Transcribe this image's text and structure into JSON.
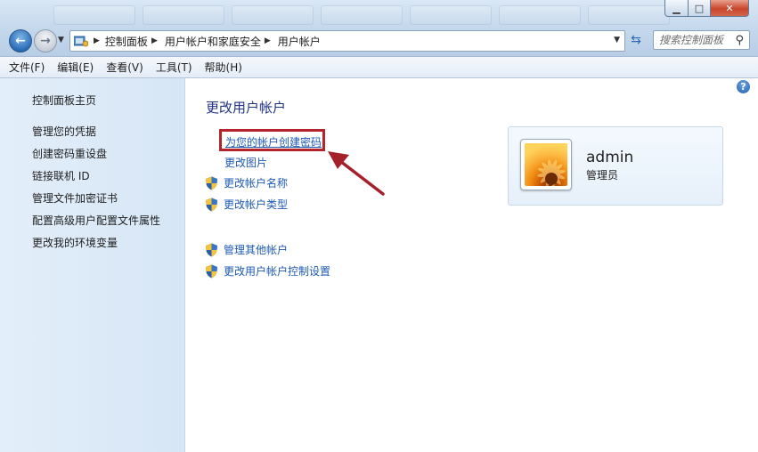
{
  "window": {
    "minimize_glyph": "▁",
    "maximize_glyph": "□",
    "close_glyph": "✕"
  },
  "address_bar": {
    "crumbs": [
      "控制面板",
      "用户帐户和家庭安全",
      "用户帐户"
    ],
    "search_placeholder": "搜索控制面板"
  },
  "menu": {
    "items": [
      "文件(F)",
      "编辑(E)",
      "查看(V)",
      "工具(T)",
      "帮助(H)"
    ]
  },
  "sidebar": {
    "items": [
      "控制面板主页",
      "管理您的凭据",
      "创建密码重设盘",
      "链接联机 ID",
      "管理文件加密证书",
      "配置高级用户配置文件属性",
      "更改我的环境变量"
    ]
  },
  "main": {
    "title": "更改用户帐户",
    "tasks": [
      "为您的帐户创建密码",
      "更改图片",
      "更改帐户名称",
      "更改帐户类型"
    ],
    "other_tasks": [
      "管理其他帐户",
      "更改用户帐户控制设置"
    ],
    "help_glyph": "?"
  },
  "user": {
    "name": "admin",
    "role": "管理员"
  },
  "colors": {
    "link": "#1e5ab4",
    "title": "#1e3287",
    "highlight": "#b4242b"
  },
  "icons": [
    "back-arrow-icon",
    "forward-arrow-icon",
    "control-panel-icon",
    "refresh-icon",
    "search-icon",
    "help-icon",
    "uac-shield-icon"
  ]
}
